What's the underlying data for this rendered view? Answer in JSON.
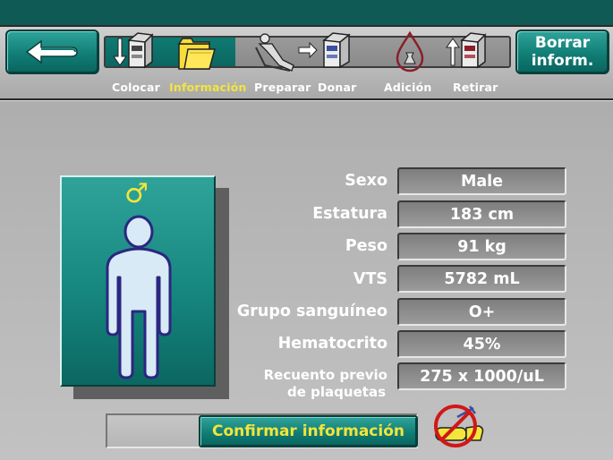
{
  "header": {
    "clear_button": [
      "Borrar",
      "inform."
    ],
    "steps": [
      {
        "label": "Colocar",
        "active": false
      },
      {
        "label": "Información",
        "active": true
      },
      {
        "label": "Preparar",
        "active": false
      },
      {
        "label": "Donar",
        "active": false
      },
      {
        "label": "Adición",
        "active": false
      },
      {
        "label": "Retirar",
        "active": false
      }
    ]
  },
  "donor": {
    "gender_symbol": "♂",
    "fields": [
      {
        "label": "Sexo",
        "value": "Male"
      },
      {
        "label": "Estatura",
        "value": "183 cm"
      },
      {
        "label": "Peso",
        "value": "91 kg"
      },
      {
        "label": "VTS",
        "value": "5782 mL"
      },
      {
        "label": "Grupo sanguíneo",
        "value": "O+"
      },
      {
        "label": "Hematocrito",
        "value": "45%"
      },
      {
        "label": [
          "Recuento previo",
          "de plaquetas"
        ],
        "value": "275 x 1000/uL"
      }
    ]
  },
  "footer": {
    "confirm_label": "Confirmar información"
  },
  "colors": {
    "teal": "#0f7b73",
    "active_label": "#f3e53a",
    "warning_red": "#d01818"
  }
}
